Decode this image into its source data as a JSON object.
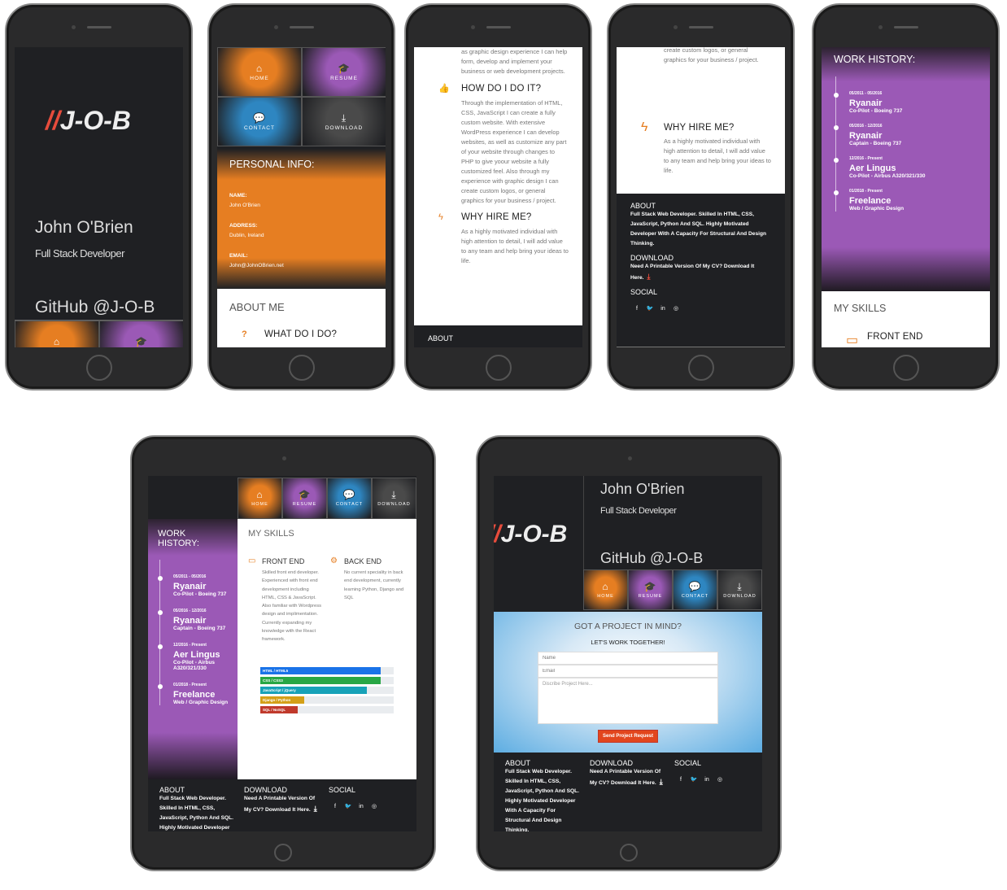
{
  "brand": {
    "logo_slashes": "//",
    "logo_text": "J-O-B",
    "name": "John O'Brien",
    "role": "Full Stack Developer",
    "github": "GitHub @J-O-B",
    "accent": "#e74c3c"
  },
  "nav": [
    {
      "label": "HOME",
      "icon": "home-icon",
      "glyph": "⌂",
      "color": "#e67e22"
    },
    {
      "label": "RESUME",
      "icon": "graduation-cap-icon",
      "glyph": "🎓",
      "color": "#9b59b6"
    },
    {
      "label": "CONTACT",
      "icon": "chat-bubble-icon",
      "glyph": "💬",
      "color": "#2e86c1"
    },
    {
      "label": "DOWNLOAD",
      "icon": "download-icon",
      "glyph": "⤓",
      "color": "#4a4a4a"
    }
  ],
  "personal_info": {
    "title": "PERSONAL INFO:",
    "color": "#e67e22",
    "fields": [
      {
        "label": "NAME:",
        "value": "John O'Brien"
      },
      {
        "label": "ADDRESS:",
        "value": "Dublin, Ireland"
      },
      {
        "label": "EMAIL:",
        "value": "John@JohnOBrien.net"
      }
    ]
  },
  "about_me": {
    "title": "ABOUT ME",
    "what_title": "WHAT DO I DO?",
    "what_tail": "as graphic design experience I can help form, develop and implement your business or web development projects.",
    "how_title": "HOW DO I DO IT?",
    "how_text": "Through the implementation of HTML, CSS, JavaScript I can create a fully custom website. With extensive WordPress experience I can develop websites, as well as customize any part of your website through changes to PHP to give yoour website a fully customized feel. Also through my experience with graphic design I can create custom logos, or general graphics for your business / project.",
    "why_title": "WHY HIRE ME?",
    "why_text": "As a highly motivated individual with high attention to detail, I will add value to any team and help bring your ideas to life."
  },
  "work_history": {
    "title": "WORK HISTORY:",
    "items": [
      {
        "dates": "05/2011 - 05/2016",
        "company": "Ryanair",
        "role": "Co-Pilot - Boeing 737"
      },
      {
        "dates": "05/2016 - 12/2016",
        "company": "Ryanair",
        "role": "Captain - Boeing 737"
      },
      {
        "dates": "12/2016 - Present",
        "company": "Aer Lingus",
        "role": "Co-Pilot - Airbus A320/321/330"
      },
      {
        "dates": "01/2018 - Present",
        "company": "Freelance",
        "role": "Web / Graphic Design"
      }
    ]
  },
  "skills": {
    "title": "MY SKILLS",
    "front_title": "FRONT END",
    "front_text": "Skilled front end developer. Experienced with front end development including HTML, CSS & JavaScript. Also familiar with Wordpress design and implimentation. Currently expanding my knowledge with the React framework.",
    "back_title": "BACK END",
    "back_text": "No current speciality in back end development, currently learning Python, Django and SQL",
    "bars": [
      {
        "label": "HTML / HTML5",
        "percent": 90,
        "color": "#1a73e8"
      },
      {
        "label": "CSS / CSS3",
        "percent": 90,
        "color": "#28a745"
      },
      {
        "label": "JavaScript / jQuery",
        "percent": 80,
        "color": "#17a2b8"
      },
      {
        "label": "Django / Python",
        "percent": 33,
        "color": "#d4a017"
      },
      {
        "label": "SQL / NoSQL",
        "percent": 28,
        "color": "#c0392b"
      }
    ]
  },
  "contact": {
    "title": "GOT A PROJECT IN MIND?",
    "subtitle": "LET'S WORK TOGETHER!",
    "name_placeholder": "Name",
    "email_placeholder": "Email",
    "message_placeholder": "Discribe Project Here...",
    "submit_label": "Send Project Request",
    "button_color": "#e2461d"
  },
  "footer": {
    "about_title": "ABOUT",
    "about_text": "Full Stack Web Developer. Skilled In HTML, CSS, JavaScript, Python And SQL. Highly Motivated Developer With A Capacity For Structural And Design Thinking.",
    "download_title": "DOWNLOAD",
    "download_text": "Need A Printable Version Of My CV? Download It Here.",
    "social_title": "SOCIAL",
    "social": [
      {
        "icon": "facebook-icon",
        "glyph": "f"
      },
      {
        "icon": "twitter-icon",
        "glyph": "🐦"
      },
      {
        "icon": "linkedin-icon",
        "glyph": "in"
      },
      {
        "icon": "instagram-icon",
        "glyph": "◎"
      }
    ]
  }
}
